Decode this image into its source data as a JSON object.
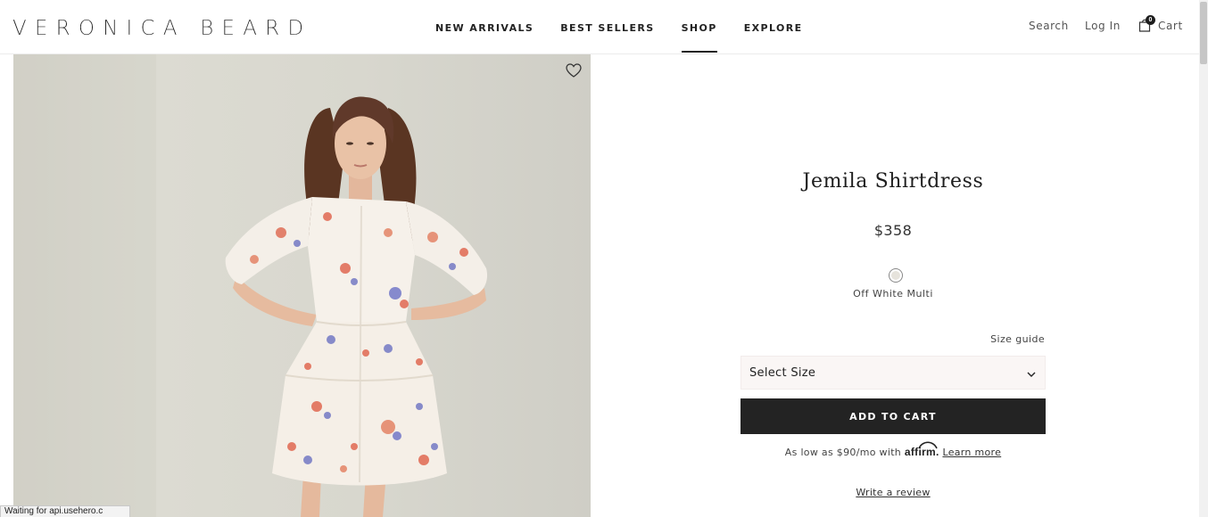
{
  "brand": {
    "logo_text": "VERONICA BEARD"
  },
  "nav": {
    "items": [
      {
        "label": "NEW ARRIVALS",
        "active": false
      },
      {
        "label": "BEST SELLERS",
        "active": false
      },
      {
        "label": "SHOP",
        "active": true
      },
      {
        "label": "EXPLORE",
        "active": false
      }
    ]
  },
  "utility": {
    "search_label": "Search",
    "login_label": "Log In",
    "cart_label": "Cart",
    "cart_count": "0",
    "cart_icon": "shopping-bag-icon"
  },
  "product": {
    "name": "Jemila Shirtdress",
    "price": "$358",
    "color_name": "Off White Multi",
    "size_guide_label": "Size guide",
    "size_select_value": "Select Size",
    "add_to_cart_label": "ADD TO CART",
    "financing": {
      "prefix": "As low as $90/mo with",
      "provider": "affirm.",
      "link": "Learn more"
    },
    "review_link": "Write a review",
    "wishlist_icon": "heart-icon"
  },
  "browser_status": "Waiting for api.usehero.c",
  "colors": {
    "accent_dark": "#232323",
    "select_bg": "#faf6f5",
    "photo_bg": "#d8d7ce"
  }
}
